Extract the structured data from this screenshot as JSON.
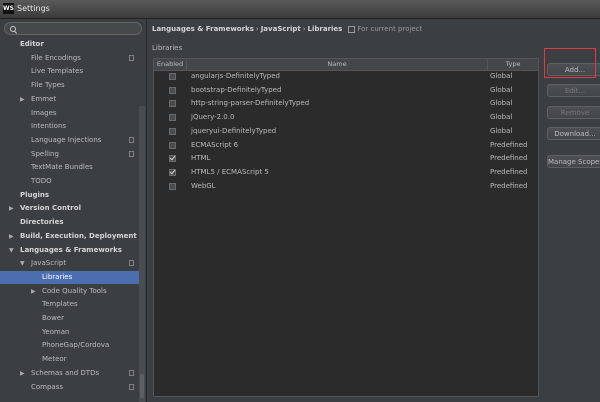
{
  "window": {
    "logo": "WS",
    "title": "Settings"
  },
  "sidebar": {
    "search_placeholder": "",
    "items": [
      {
        "label": "Editor",
        "level": 0,
        "bold": true,
        "arrow": "",
        "copy": false,
        "selected": false
      },
      {
        "label": "File Encodings",
        "level": 1,
        "bold": false,
        "arrow": "",
        "copy": true,
        "selected": false
      },
      {
        "label": "Live Templates",
        "level": 1,
        "bold": false,
        "arrow": "",
        "copy": false,
        "selected": false
      },
      {
        "label": "File Types",
        "level": 1,
        "bold": false,
        "arrow": "",
        "copy": false,
        "selected": false
      },
      {
        "label": "Emmet",
        "level": 1,
        "bold": false,
        "arrow": "▶",
        "copy": false,
        "selected": false
      },
      {
        "label": "Images",
        "level": 1,
        "bold": false,
        "arrow": "",
        "copy": false,
        "selected": false
      },
      {
        "label": "Intentions",
        "level": 1,
        "bold": false,
        "arrow": "",
        "copy": false,
        "selected": false
      },
      {
        "label": "Language Injections",
        "level": 1,
        "bold": false,
        "arrow": "",
        "copy": true,
        "selected": false
      },
      {
        "label": "Spelling",
        "level": 1,
        "bold": false,
        "arrow": "",
        "copy": true,
        "selected": false
      },
      {
        "label": "TextMate Bundles",
        "level": 1,
        "bold": false,
        "arrow": "",
        "copy": false,
        "selected": false
      },
      {
        "label": "TODO",
        "level": 1,
        "bold": false,
        "arrow": "",
        "copy": false,
        "selected": false
      },
      {
        "label": "Plugins",
        "level": 0,
        "bold": true,
        "arrow": "",
        "copy": false,
        "selected": false
      },
      {
        "label": "Version Control",
        "level": 0,
        "bold": true,
        "arrow": "▶",
        "copy": false,
        "selected": false
      },
      {
        "label": "Directories",
        "level": 0,
        "bold": true,
        "arrow": "",
        "copy": false,
        "selected": false
      },
      {
        "label": "Build, Execution, Deployment",
        "level": 0,
        "bold": true,
        "arrow": "▶",
        "copy": false,
        "selected": false
      },
      {
        "label": "Languages & Frameworks",
        "level": 0,
        "bold": true,
        "arrow": "▼",
        "copy": false,
        "selected": false
      },
      {
        "label": "JavaScript",
        "level": 1,
        "bold": false,
        "arrow": "▼",
        "copy": true,
        "selected": false
      },
      {
        "label": "Libraries",
        "level": 2,
        "bold": false,
        "arrow": "",
        "copy": false,
        "selected": true
      },
      {
        "label": "Code Quality Tools",
        "level": 2,
        "bold": false,
        "arrow": "▶",
        "copy": false,
        "selected": false
      },
      {
        "label": "Templates",
        "level": 2,
        "bold": false,
        "arrow": "",
        "copy": false,
        "selected": false
      },
      {
        "label": "Bower",
        "level": 2,
        "bold": false,
        "arrow": "",
        "copy": false,
        "selected": false
      },
      {
        "label": "Yeoman",
        "level": 2,
        "bold": false,
        "arrow": "",
        "copy": false,
        "selected": false
      },
      {
        "label": "PhoneGap/Cordova",
        "level": 2,
        "bold": false,
        "arrow": "",
        "copy": false,
        "selected": false
      },
      {
        "label": "Meteor",
        "level": 2,
        "bold": false,
        "arrow": "",
        "copy": false,
        "selected": false
      },
      {
        "label": "Schemas and DTDs",
        "level": 1,
        "bold": false,
        "arrow": "▶",
        "copy": true,
        "selected": false
      },
      {
        "label": "Compass",
        "level": 1,
        "bold": false,
        "arrow": "",
        "copy": true,
        "selected": false
      }
    ]
  },
  "breadcrumb": {
    "parts": [
      "Languages & Frameworks",
      "JavaScript",
      "Libraries"
    ],
    "separator": "›",
    "note": "For current project"
  },
  "libraries": {
    "section_label": "Libraries",
    "columns": {
      "enabled": "Enabled",
      "name": "Name",
      "type": "Type"
    },
    "rows": [
      {
        "enabled": false,
        "name": "angularjs-DefinitelyTyped",
        "type": "Global"
      },
      {
        "enabled": false,
        "name": "bootstrap-DefinitelyTyped",
        "type": "Global"
      },
      {
        "enabled": false,
        "name": "http-string-parser-DefinitelyTyped",
        "type": "Global"
      },
      {
        "enabled": false,
        "name": "jQuery-2.0.0",
        "type": "Global"
      },
      {
        "enabled": false,
        "name": "jqueryui-DefinitelyTyped",
        "type": "Global"
      },
      {
        "enabled": false,
        "name": "ECMAScript 6",
        "type": "Predefined"
      },
      {
        "enabled": true,
        "name": "HTML",
        "type": "Predefined"
      },
      {
        "enabled": true,
        "name": "HTML5 / ECMAScript 5",
        "type": "Predefined"
      },
      {
        "enabled": false,
        "name": "WebGL",
        "type": "Predefined"
      }
    ]
  },
  "buttons": [
    {
      "label": "Add...",
      "enabled": true
    },
    {
      "label": "Edit...",
      "enabled": false
    },
    {
      "label": "Remove",
      "enabled": false
    },
    {
      "label": "Download...",
      "enabled": true
    },
    {
      "label": "Manage Scopes...",
      "enabled": true
    }
  ]
}
